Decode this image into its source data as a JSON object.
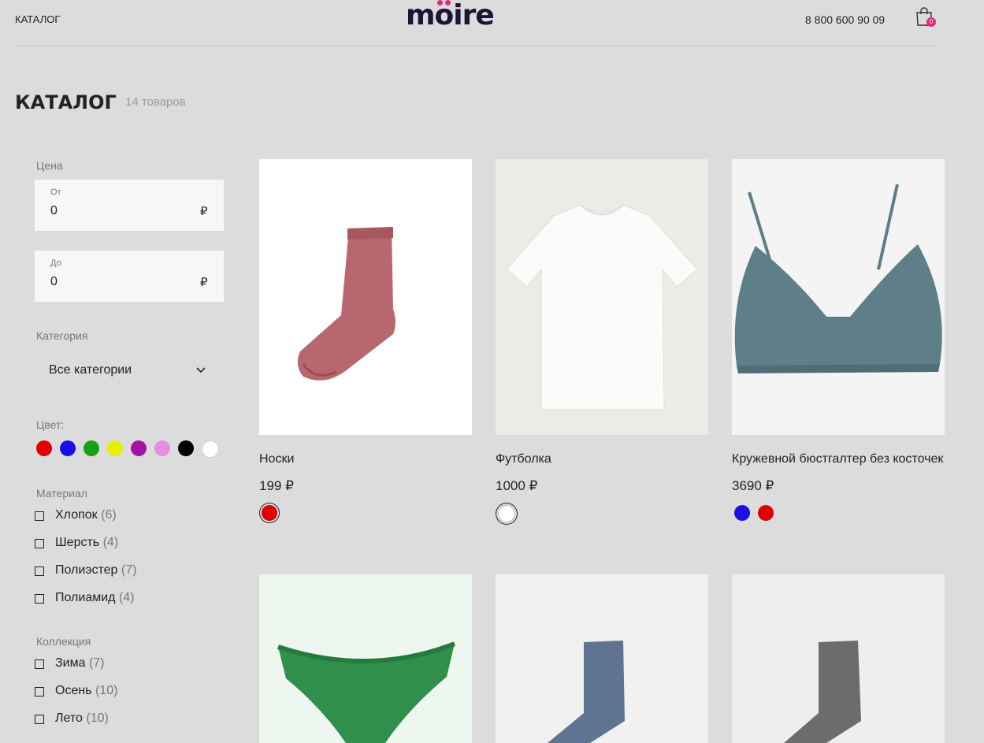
{
  "header": {
    "nav_catalog": "КАТАЛОГ",
    "logo": "moire",
    "phone": "8 800 600 90 09",
    "cart_count": "0",
    "accent_color": "#e02b7a"
  },
  "page": {
    "title": "КАТАЛОГ",
    "count": "14 товаров"
  },
  "filters": {
    "price_label": "Цена",
    "from_label": "От",
    "from_value": "0",
    "to_label": "До",
    "to_value": "0",
    "currency": "₽",
    "category_label": "Категория",
    "category_value": "Все категории",
    "color_label": "Цвет:",
    "colors": [
      "#e00000",
      "#1a10e6",
      "#16a116",
      "#e6f000",
      "#a414a4",
      "#e58ee0",
      "#000000",
      "#ffffff"
    ],
    "material_label": "Материал",
    "materials": [
      {
        "label": "Хлопок",
        "count": "(6)"
      },
      {
        "label": "Шерсть",
        "count": "(4)"
      },
      {
        "label": "Полиэстер",
        "count": "(7)"
      },
      {
        "label": "Полиамид",
        "count": "(4)"
      }
    ],
    "collection_label": "Коллекция",
    "collections": [
      {
        "label": "Зима",
        "count": "(7)"
      },
      {
        "label": "Осень",
        "count": "(10)"
      },
      {
        "label": "Лето",
        "count": "(10)"
      }
    ]
  },
  "products": [
    {
      "title": "Носки",
      "price": "199 ₽",
      "image": "pink-sock",
      "colors": [
        "#e00000"
      ]
    },
    {
      "title": "Футболка",
      "price": "1000 ₽",
      "image": "white-tshirt",
      "colors": [
        "#ffffff"
      ]
    },
    {
      "title": "Кружевной бюстгалтер без косточек",
      "price": "3690 ₽",
      "image": "teal-lace-bra",
      "colors": [
        "#1a10e6",
        "#e00000"
      ]
    },
    {
      "image": "green-briefs"
    },
    {
      "image": "blue-sock"
    },
    {
      "image": "grey-sock"
    }
  ]
}
